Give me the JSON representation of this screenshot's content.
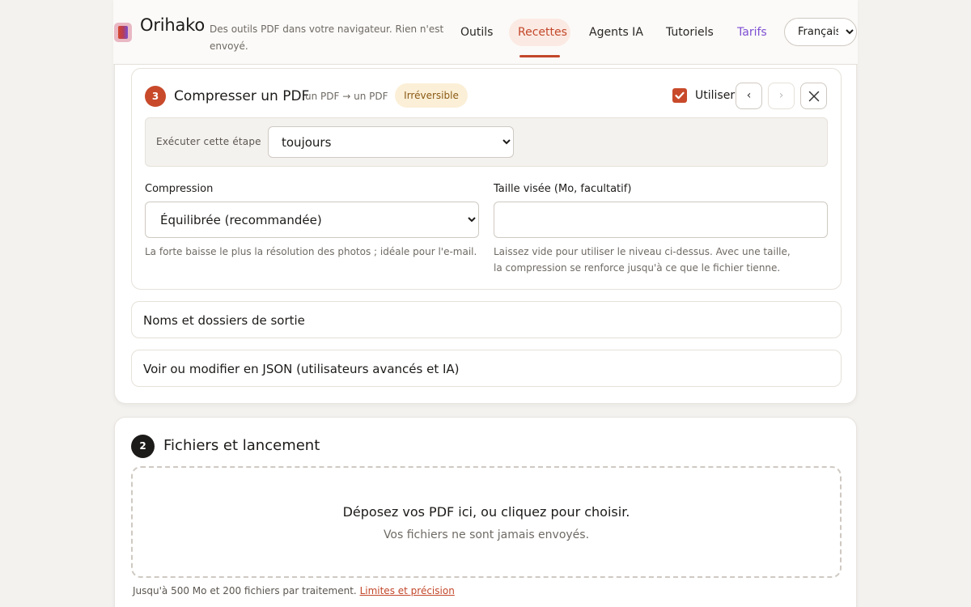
{
  "header": {
    "brand": "Orihako",
    "tagline": "Des outils PDF dans votre navigateur. Rien n'est envoyé.",
    "nav": [
      {
        "label": "Outils"
      },
      {
        "label": "Recettes"
      },
      {
        "label": "Agents IA"
      },
      {
        "label": "Tutoriels"
      },
      {
        "label": "Tarifs"
      }
    ],
    "language": "Français"
  },
  "step": {
    "number": "3",
    "title": "Compresser un PDF",
    "io": "un PDF → un PDF",
    "badge": "Irréversible",
    "use_label": "Utiliser",
    "use_checked": true,
    "prev_label": "‹",
    "next_label": "›",
    "condition_label": "Exécuter cette étape",
    "condition_value": "toujours",
    "compression_label": "Compression",
    "compression_value": "Équilibrée (recommandée)",
    "compression_help": "La forte baisse le plus la résolution des photos ; idéale pour l'e-mail.",
    "target_label": "Taille visée (Mo, facultatif)",
    "target_value": "",
    "target_help": "Laissez vide pour utiliser le niveau ci-dessus. Avec une taille, la compression se renforce jusqu'à ce que le fichier tienne."
  },
  "accordions": {
    "output": "Noms et dossiers de sortie",
    "json": "Voir ou modifier en JSON (utilisateurs avancés et IA)"
  },
  "files": {
    "number": "2",
    "title": "Fichiers et lancement",
    "drop_main": "Déposez vos PDF ici, ou cliquez pour choisir.",
    "drop_sub": "Vos fichiers ne sont jamais envoyés.",
    "limits_text": "Jusqu'à 500 Mo et 200 fichiers par traitement. ",
    "limits_link": "Limites et précision"
  },
  "colors": {
    "accent": "#c84a2b",
    "purple": "#7e4fd4",
    "warning_bg": "#fbefd7"
  }
}
